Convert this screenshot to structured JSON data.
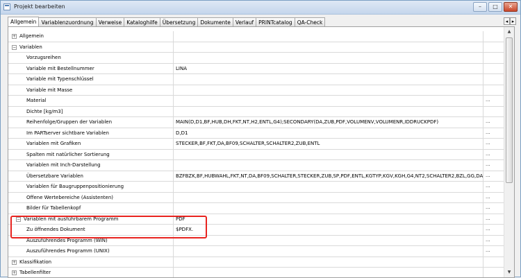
{
  "window": {
    "title": "Projekt bearbeiten",
    "min_label": "–",
    "max_label": "□",
    "close_label": "✕"
  },
  "tabs": [
    {
      "label": "Allgemein"
    },
    {
      "label": "Variablenzuordnung"
    },
    {
      "label": "Verweise"
    },
    {
      "label": "Kataloghilfe"
    },
    {
      "label": "Übersetzung"
    },
    {
      "label": "Dokumente"
    },
    {
      "label": "Verlauf"
    },
    {
      "label": "PRINTcatalog"
    },
    {
      "label": "QA-Check"
    }
  ],
  "tab_scroll": {
    "left": "◂",
    "right": "▸"
  },
  "grid": {
    "rows": [
      {
        "label": "Allgemein",
        "value": "",
        "btn": "",
        "level": 0,
        "expander": "+"
      },
      {
        "label": "Variablen",
        "value": "",
        "btn": "",
        "level": 0,
        "expander": "−"
      },
      {
        "label": "Vorzugsreihen",
        "value": "",
        "btn": "",
        "level": 2,
        "expander": ""
      },
      {
        "label": "Variable mit Bestellnummer",
        "value": "LINA",
        "btn": "",
        "level": 2,
        "expander": ""
      },
      {
        "label": "Variable mit Typenschlüssel",
        "value": "",
        "btn": "",
        "level": 2,
        "expander": ""
      },
      {
        "label": "Variable mit Masse",
        "value": "",
        "btn": "",
        "level": 2,
        "expander": ""
      },
      {
        "label": "Material",
        "value": "",
        "btn": "...",
        "level": 2,
        "expander": ""
      },
      {
        "label": "Dichte [kg/m3]",
        "value": "",
        "btn": "",
        "level": 2,
        "expander": ""
      },
      {
        "label": "Reihenfolge/Gruppen der Variablen",
        "value": "MAIN(D,D1,BF,HUB,DH,FKT,NT,H2,ENTL,G4);SECONDARY(DA,ZUB,PDF,VOLUMENV,VOLUMENR,IDDRUCKPDF)",
        "btn": "...",
        "level": 2,
        "expander": ""
      },
      {
        "label": "Im PARTserver sichtbare Variablen",
        "value": "D,D1",
        "btn": "...",
        "level": 2,
        "expander": ""
      },
      {
        "label": "Variablen mit Grafiken",
        "value": "STECKER,BF,FKT,DA,BF09,SCHALTER,SCHALTER2,ZUB,ENTL",
        "btn": "...",
        "level": 2,
        "expander": ""
      },
      {
        "label": "Spalten mit natürlicher Sortierung",
        "value": "",
        "btn": "...",
        "level": 2,
        "expander": ""
      },
      {
        "label": "Variablen mit Inch-Darstellung",
        "value": "",
        "btn": "...",
        "level": 2,
        "expander": ""
      },
      {
        "label": "Übersetzbare Variablen",
        "value": "BZFBZK,BF,HUBWAHL,FKT,NT,DA,BF09,SCHALTER,STECKER,ZUB,SP,PDF,ENTL,KGTYP,KGV,KGH,G4,NT2,SCHALTER2,BZL,GG,DA2,H",
        "btn": "...",
        "level": 2,
        "expander": ""
      },
      {
        "label": "Variablen für Baugruppenpositionierung",
        "value": "",
        "btn": "...",
        "level": 2,
        "expander": ""
      },
      {
        "label": "Offene Wertebereiche (Assistenten)",
        "value": "",
        "btn": "...",
        "level": 2,
        "expander": ""
      },
      {
        "label": "Bilder für Tabellenkopf",
        "value": "",
        "btn": "...",
        "level": 2,
        "expander": ""
      },
      {
        "label": "Variablen mit ausführbarem Programm",
        "value": "PDF",
        "btn": "...",
        "level": 1,
        "expander": "−"
      },
      {
        "label": "Zu öffnendes Dokument",
        "value": "$PDFX.",
        "btn": "...",
        "level": 2,
        "expander": ""
      },
      {
        "label": "Auszuführendes Programm (WIN)",
        "value": "",
        "btn": "...",
        "level": 2,
        "expander": ""
      },
      {
        "label": "Auszuführendes Programm (UNIX)",
        "value": "",
        "btn": "...",
        "level": 2,
        "expander": ""
      },
      {
        "label": "Klassifikation",
        "value": "",
        "btn": "",
        "level": 0,
        "expander": "+"
      },
      {
        "label": "Tabellenfilter",
        "value": "",
        "btn": "",
        "level": 0,
        "expander": "+"
      }
    ]
  },
  "highlight_color": "#e8231f"
}
